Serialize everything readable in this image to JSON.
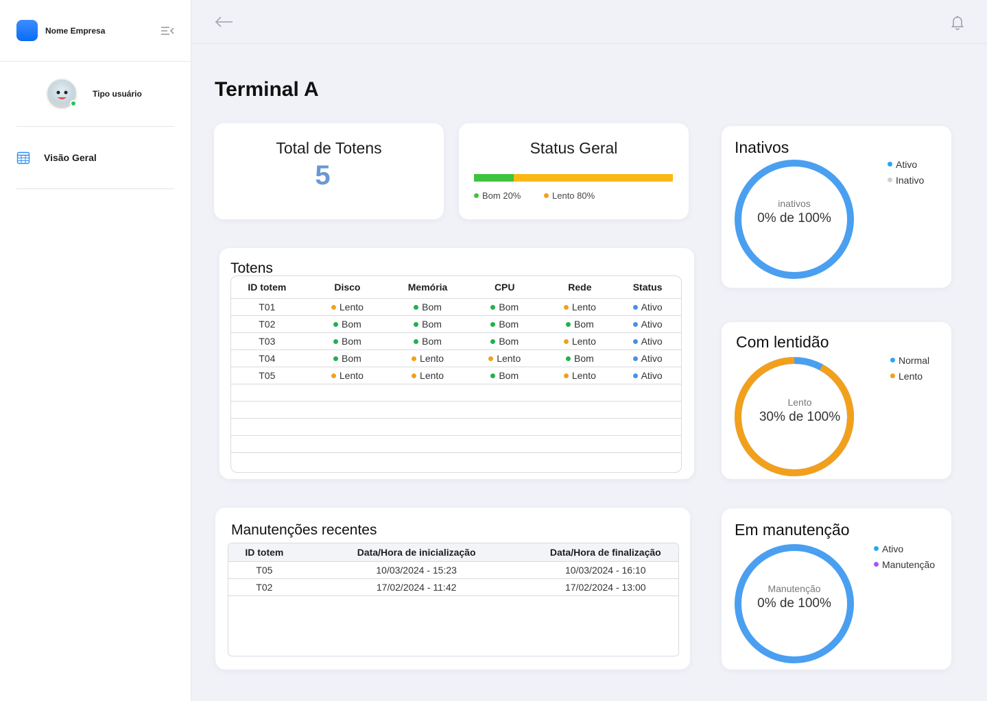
{
  "sidebar": {
    "company": "Nome Empresa",
    "user_type": "Tipo usuário",
    "nav": [
      {
        "label": "Visão Geral"
      }
    ]
  },
  "page": {
    "title": "Terminal A"
  },
  "total_card": {
    "title": "Total de Totens",
    "value": "5"
  },
  "status_card": {
    "title": "Status Geral",
    "good_fraction": 0.2,
    "slow_fraction": 0.8,
    "good_label": "Bom 20%",
    "slow_label": "Lento 80%",
    "good_color": "#3ec33e",
    "slow_color": "#fbb714"
  },
  "totens": {
    "title": "Totens",
    "headers": [
      "ID totem",
      "Disco",
      "Memória",
      "CPU",
      "Rede",
      "Status"
    ],
    "rows": [
      [
        "T01",
        "Lento",
        "Bom",
        "Bom",
        "Lento",
        "Ativo"
      ],
      [
        "T02",
        "Bom",
        "Bom",
        "Bom",
        "Bom",
        "Ativo"
      ],
      [
        "T03",
        "Bom",
        "Bom",
        "Bom",
        "Lento",
        "Ativo"
      ],
      [
        "T04",
        "Bom",
        "Lento",
        "Lento",
        "Bom",
        "Ativo"
      ],
      [
        "T05",
        "Lento",
        "Lento",
        "Bom",
        "Lento",
        "Ativo"
      ]
    ],
    "status_colors": {
      "Bom": "#22b14c",
      "Lento": "#f2a01c",
      "Ativo": "#4a90e2"
    }
  },
  "manutencoes": {
    "title": "Manutenções recentes",
    "headers": [
      "ID totem",
      "Data/Hora de inicialização",
      "Data/Hora de finalização"
    ],
    "rows": [
      [
        "T05",
        "10/03/2024 - 15:23",
        "10/03/2024 - 16:10"
      ],
      [
        "T02",
        "17/02/2024 - 11:42",
        "17/02/2024 - 13:00"
      ]
    ]
  },
  "donuts": {
    "inativos": {
      "title": "Inativos",
      "center_small": "inativos",
      "center_large": "0% de 100%",
      "fraction": 0.0,
      "base_color": "#4a9ff0",
      "fill_color": "#d0d0d0",
      "legend": [
        {
          "label": "Ativo",
          "color": "#2aa6f2"
        },
        {
          "label": "Inativo",
          "color": "#d0d0d0"
        }
      ]
    },
    "lentidao": {
      "title": "Com lentidão",
      "center_small": "Lento",
      "center_large": "30% de 100%",
      "fraction": 0.92,
      "base_color": "#4a9ff0",
      "fill_color": "#f2a01c",
      "legend": [
        {
          "label": "Normal",
          "color": "#2aa6f2"
        },
        {
          "label": "Lento",
          "color": "#f2a01c"
        }
      ]
    },
    "manutencao": {
      "title": "Em manutenção",
      "center_small": "Manutenção",
      "center_large": "0% de 100%",
      "fraction": 0.0,
      "base_color": "#4a9ff0",
      "fill_color": "#a855f7",
      "legend": [
        {
          "label": "Ativo",
          "color": "#2aa6f2"
        },
        {
          "label": "Manutenção",
          "color": "#a855f7"
        }
      ]
    }
  }
}
